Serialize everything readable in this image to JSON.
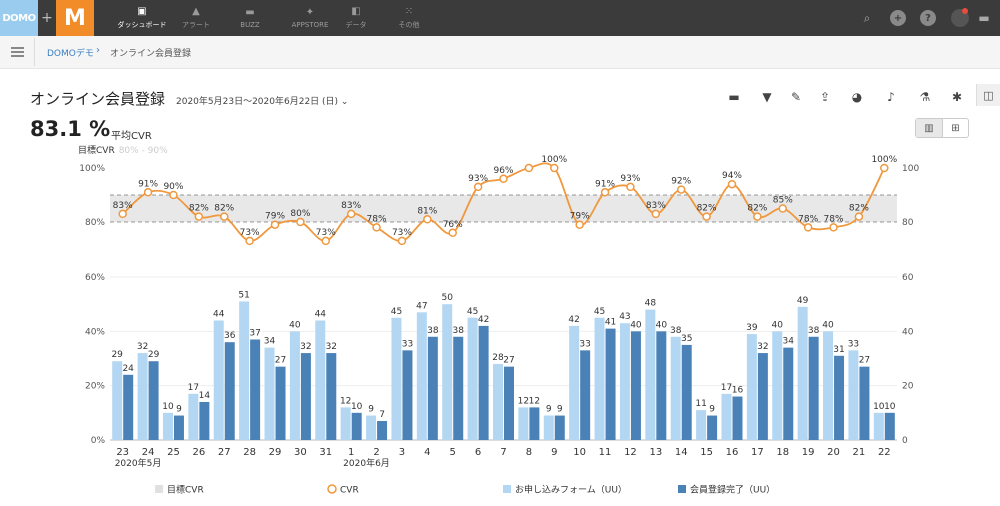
{
  "nav": {
    "logo_domo": "DOMO",
    "logo_plus": "+",
    "logo_m": "M",
    "items": [
      {
        "label": "ダッシュボード",
        "icon": "dashboard-icon",
        "active": true
      },
      {
        "label": "アラート",
        "icon": "bell-icon",
        "active": false
      },
      {
        "label": "BUZZ",
        "icon": "chat-icon",
        "active": false
      },
      {
        "label": "APPSTORE",
        "icon": "appstore-icon",
        "active": false
      },
      {
        "label": "データ",
        "icon": "database-icon",
        "active": false
      },
      {
        "label": "その他",
        "icon": "grid-icon",
        "active": false
      }
    ],
    "right_icons": [
      "search-icon",
      "plus-icon",
      "help-icon",
      "avatar",
      "chat-icon"
    ]
  },
  "breadcrumb": {
    "root": "DOMOデモ",
    "current": "オンライン会員登録"
  },
  "card": {
    "title": "オンライン会員登録",
    "date_range": "2020年5月23日〜2020年6月22日 (日)",
    "tools": [
      "comment-icon",
      "filter-icon",
      "pencil-icon",
      "share-icon",
      "pie-icon",
      "bell-icon",
      "flask-icon",
      "wrench-icon"
    ],
    "kpi_value": "83.1 %",
    "kpi_label": "平均CVR",
    "target_label": "目標CVR",
    "target_value": "80% - 90%"
  },
  "chart_data": {
    "type": "bar",
    "categories": [
      "23",
      "24",
      "25",
      "26",
      "27",
      "28",
      "29",
      "30",
      "31",
      "1",
      "2",
      "3",
      "4",
      "5",
      "6",
      "7",
      "8",
      "9",
      "10",
      "11",
      "12",
      "13",
      "14",
      "15",
      "16",
      "17",
      "18",
      "19",
      "20",
      "21",
      "22"
    ],
    "month_labels": [
      {
        "label": "2020年5月",
        "at": "23"
      },
      {
        "label": "2020年6月",
        "at": "1"
      }
    ],
    "series": [
      {
        "name": "お申し込みフォーム（UU）",
        "type": "bar",
        "color": "#b3d7f2",
        "values": [
          29,
          32,
          10,
          17,
          44,
          51,
          34,
          40,
          44,
          12,
          9,
          45,
          47,
          50,
          45,
          28,
          12,
          9,
          42,
          45,
          43,
          48,
          38,
          11,
          17,
          39,
          40,
          49,
          40,
          33,
          10
        ]
      },
      {
        "name": "会員登録完了（UU）",
        "type": "bar",
        "color": "#4a82b8",
        "values": [
          24,
          29,
          9,
          14,
          36,
          37,
          27,
          32,
          32,
          10,
          7,
          33,
          38,
          38,
          42,
          27,
          12,
          9,
          33,
          41,
          40,
          40,
          35,
          9,
          16,
          32,
          34,
          38,
          31,
          27,
          10
        ]
      },
      {
        "name": "CVR",
        "type": "line",
        "color": "#f0983e",
        "values": [
          83,
          91,
          90,
          82,
          82,
          73,
          79,
          80,
          73,
          83,
          78,
          73,
          81,
          76,
          93,
          96,
          100,
          100,
          79,
          91,
          93,
          83,
          92,
          82,
          94,
          82,
          85,
          78,
          78,
          82,
          100
        ],
        "labels": [
          "83%",
          "91%",
          "90%",
          "82%",
          "82%",
          "73%",
          "79%",
          "80%",
          "73%",
          "83%",
          "78%",
          "73%",
          "81%",
          "76%",
          "93%",
          "96%",
          "",
          "100%",
          "79%",
          "91%",
          "93%",
          "83%",
          "92%",
          "82%",
          "94%",
          "82%",
          "85%",
          "78%",
          "78%",
          "82%",
          "100%"
        ]
      }
    ],
    "target_band": {
      "name": "目標CVR",
      "from": 80,
      "to": 90,
      "color": "#e8e8e8"
    },
    "upper_axis": {
      "left_ticks": [
        "100%",
        "80%"
      ],
      "right_ticks": [
        "100",
        "80"
      ],
      "range": [
        70,
        100
      ]
    },
    "lower_axis": {
      "left_ticks": [
        "60%",
        "40%",
        "20%",
        "0%"
      ],
      "right_ticks": [
        "60",
        "40",
        "20",
        "0"
      ],
      "range": [
        0,
        60
      ]
    },
    "legend": [
      {
        "label": "目標CVR",
        "kind": "band",
        "color": "#e0e0e0"
      },
      {
        "label": "CVR",
        "kind": "circle",
        "color": "#f0983e"
      },
      {
        "label": "お申し込みフォーム（UU）",
        "kind": "square",
        "color": "#b3d7f2"
      },
      {
        "label": "会員登録完了（UU）",
        "kind": "square",
        "color": "#4a82b8"
      }
    ],
    "legend_position": "bottom"
  }
}
